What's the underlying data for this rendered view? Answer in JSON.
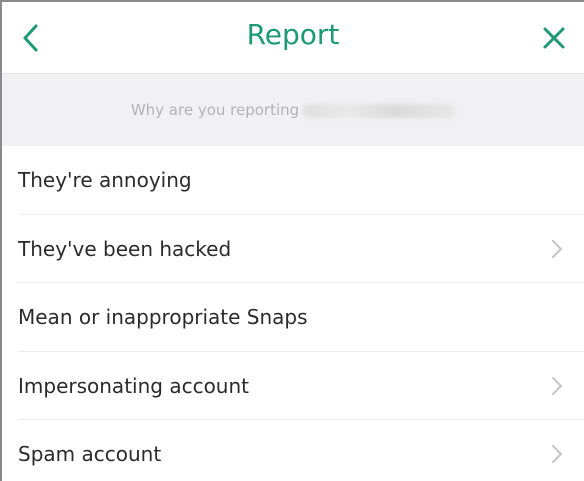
{
  "header": {
    "title": "Report",
    "back_icon": "chevron-left-icon",
    "close_icon": "close-icon"
  },
  "prompt": {
    "text": "Why are you reporting",
    "name_hidden": "blurred-username"
  },
  "options": [
    {
      "label": "They're annoying",
      "has_chevron": false
    },
    {
      "label": "They've been hacked",
      "has_chevron": true
    },
    {
      "label": "Mean or inappropriate Snaps",
      "has_chevron": false
    },
    {
      "label": "Impersonating account",
      "has_chevron": true
    },
    {
      "label": "Spam account",
      "has_chevron": true
    }
  ],
  "colors": {
    "accent": "#1d9a73",
    "subheader_bg": "#f1f1f3",
    "text": "#2b2b2b",
    "muted": "#b3b3b3",
    "chevron": "#c4c4c4"
  }
}
